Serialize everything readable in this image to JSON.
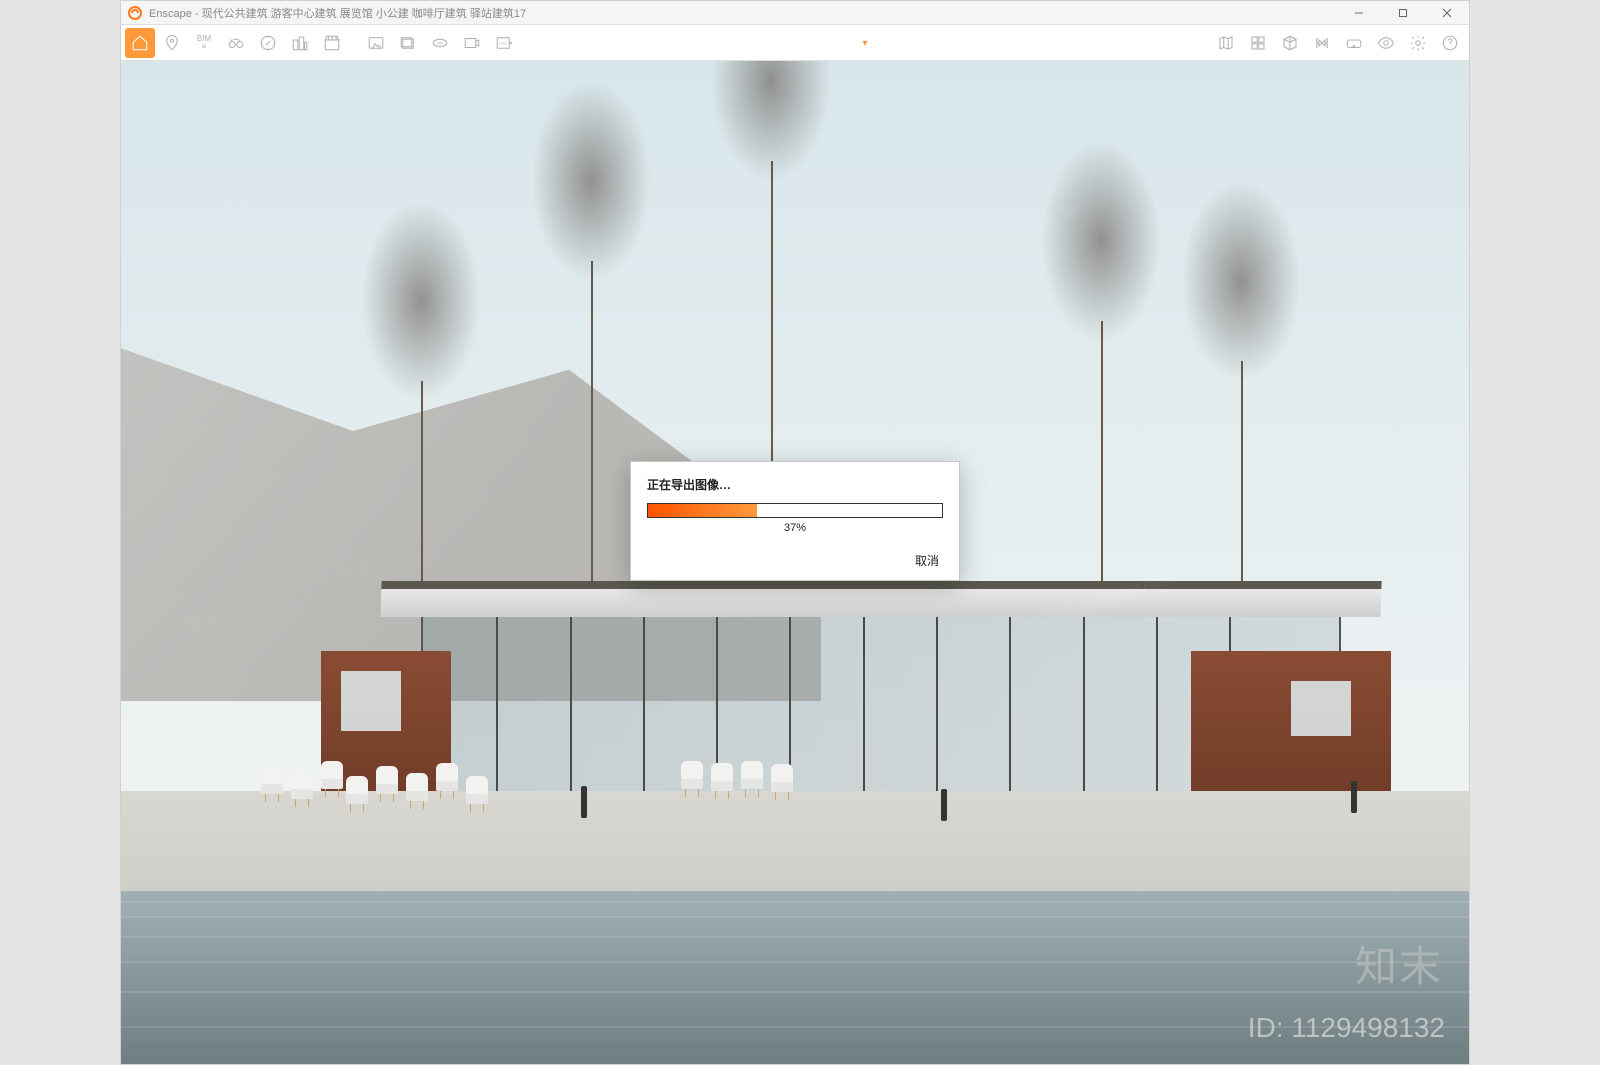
{
  "app": {
    "name": "Enscape",
    "title": "Enscape - 现代公共建筑 游客中心建筑 展览馆 小公建 咖啡厅建筑 驿站建筑17"
  },
  "toolbar": {
    "bim_label": "BIM"
  },
  "dialog": {
    "title": "正在导出图像…",
    "percent_value": 37,
    "percent_label": "37%",
    "cancel_label": "取消"
  },
  "watermark": {
    "brand": "知末",
    "id_label": "ID: 1129498132",
    "domain": "知末网 www.znzmo.com"
  },
  "colors": {
    "accent": "#ff7a1a",
    "progress_start": "#ff5400",
    "progress_end": "#ff9a3d"
  }
}
